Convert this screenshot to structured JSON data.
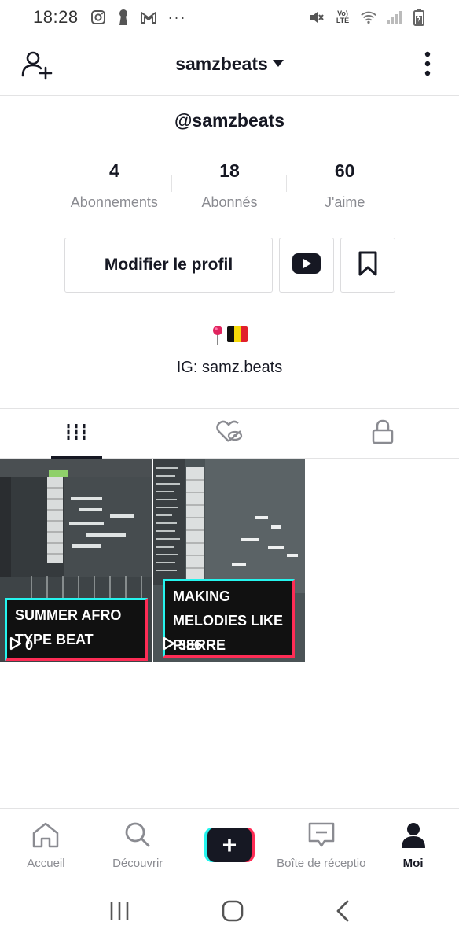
{
  "status_bar": {
    "time": "18:28",
    "network": "LTE",
    "volte": "Vo)",
    "left_icons": [
      "instagram-icon",
      "keyhole-icon",
      "gmail-icon"
    ],
    "dots": "···",
    "right_icons": [
      "mute-icon",
      "volte-icon",
      "wifi-icon",
      "signal-icon",
      "battery-icon"
    ]
  },
  "header": {
    "username": "samzbeats",
    "left_icon": "add-user-icon",
    "right_icon": "more-vertical-icon"
  },
  "profile": {
    "handle": "@samzbeats",
    "stats": [
      {
        "value": "4",
        "label": "Abonnements"
      },
      {
        "value": "18",
        "label": "Abonnés"
      },
      {
        "value": "60",
        "label": "J'aime"
      }
    ],
    "edit_button": "Modifier le profil",
    "youtube_icon": "youtube-icon",
    "bookmark_icon": "bookmark-icon",
    "bio_emoji": [
      "pin-icon",
      "belgium-flag"
    ],
    "bio_text": "IG: samz.beats"
  },
  "tabs": [
    {
      "icon": "videos-grid-icon",
      "active": true
    },
    {
      "icon": "liked-hidden-icon",
      "active": false
    },
    {
      "icon": "lock-icon",
      "active": false
    }
  ],
  "videos": [
    {
      "caption_line1": "SUMMER AFRO",
      "caption_line2": "TYPE BEAT",
      "views": "0"
    },
    {
      "caption_line1": "MAKING",
      "caption_line2": "MELODIES LIKE",
      "caption_line3": "PIERRE BOURNE",
      "views": "386"
    }
  ],
  "bottom_nav": [
    {
      "label": "Accueil",
      "icon": "home-icon",
      "active": false
    },
    {
      "label": "Découvrir",
      "icon": "search-icon",
      "active": false
    },
    {
      "label": "",
      "icon": "create-plus-icon",
      "active": false
    },
    {
      "label": "Boîte de réceptio",
      "icon": "inbox-icon",
      "active": false
    },
    {
      "label": "Moi",
      "icon": "profile-icon",
      "active": true
    }
  ],
  "colors": {
    "accent_cyan": "#25f4ee",
    "accent_red": "#fe2c55",
    "text_primary": "#161823",
    "text_secondary": "#8a8b91"
  }
}
